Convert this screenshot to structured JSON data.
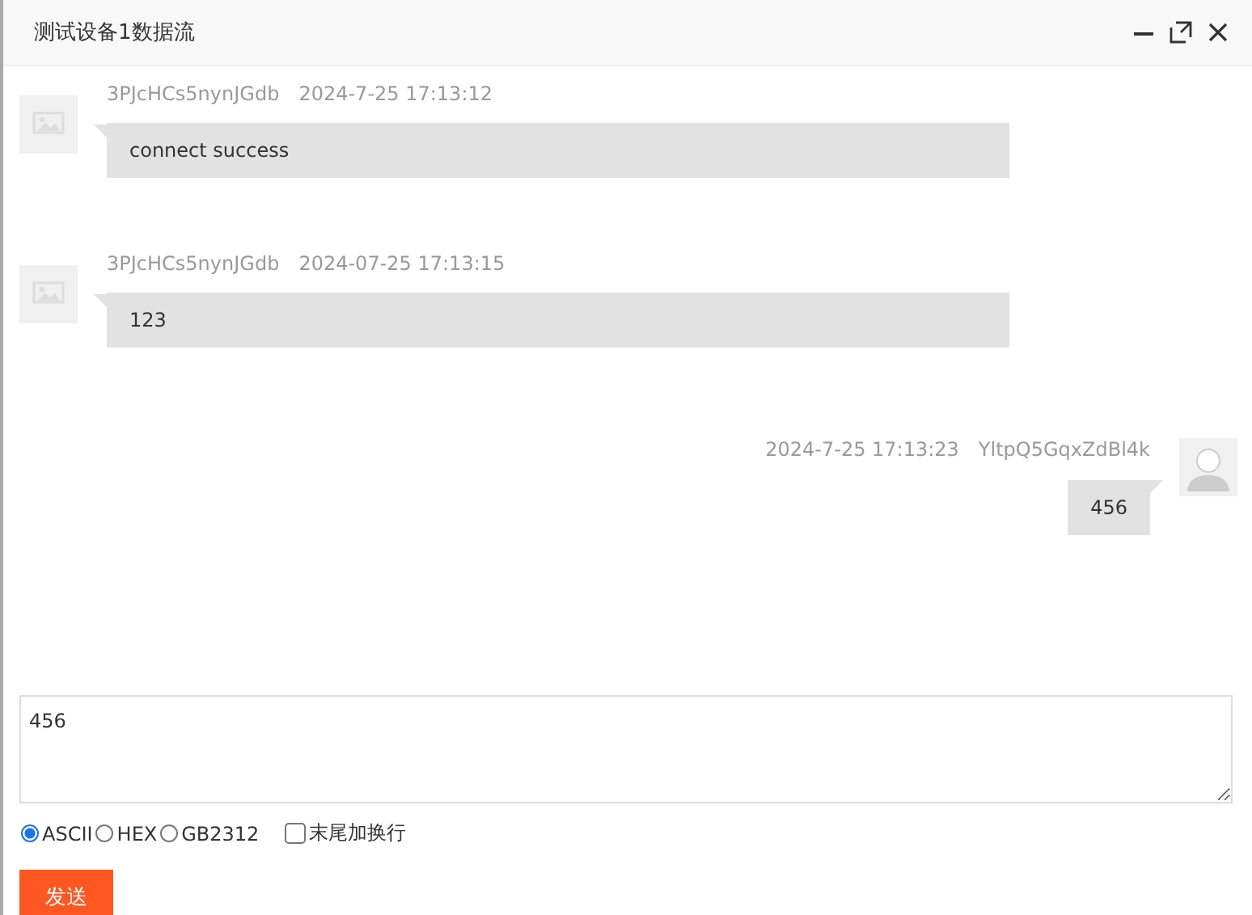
{
  "window": {
    "title": "测试设备1数据流"
  },
  "messages": [
    {
      "kind": "received",
      "sender": "3PJcHCs5nynJGdb",
      "time": "2024-7-25 17:13:12",
      "text": "connect success"
    },
    {
      "kind": "received",
      "sender": "3PJcHCs5nynJGdb",
      "time": "2024-07-25 17:13:15",
      "text": "123"
    },
    {
      "kind": "sent",
      "sender": "YltpQ5GqxZdBl4k",
      "time": "2024-7-25 17:13:23",
      "text": "456"
    }
  ],
  "input": {
    "value": "456"
  },
  "encodings": [
    {
      "label": "ASCII",
      "selected": true
    },
    {
      "label": "HEX",
      "selected": false
    },
    {
      "label": "GB2312",
      "selected": false
    }
  ],
  "newline_option": {
    "label": "末尾加换行",
    "checked": false
  },
  "send_button": "发送"
}
